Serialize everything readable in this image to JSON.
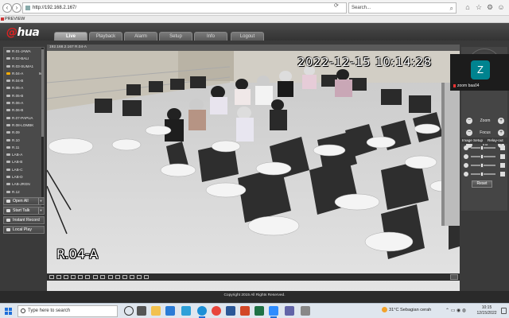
{
  "browser": {
    "url": "http://192.168.2.167/",
    "search_placeholder": "Search...",
    "tab_label": "PREVIEW"
  },
  "app": {
    "logo_main": "a",
    "logo_rest": "hua",
    "nav_tabs": [
      {
        "label": "Live",
        "active": true
      },
      {
        "label": "Playback",
        "active": false
      },
      {
        "label": "Alarm",
        "active": false
      },
      {
        "label": "Setup",
        "active": false
      },
      {
        "label": "Info",
        "active": false
      },
      {
        "label": "Logout",
        "active": false
      }
    ],
    "channels": [
      {
        "label": "R.01-JAWA",
        "active": false
      },
      {
        "label": "R.02-BALI",
        "active": false
      },
      {
        "label": "R.03-SUMA1",
        "active": false
      },
      {
        "label": "R.04-A",
        "active": true,
        "marker": "M"
      },
      {
        "label": "R.04-B",
        "active": false
      },
      {
        "label": "R.05-A",
        "active": false
      },
      {
        "label": "R.05-B",
        "active": false
      },
      {
        "label": "R.06-A",
        "active": false
      },
      {
        "label": "R.06-B",
        "active": false
      },
      {
        "label": "R.07-PAPUA",
        "active": false
      },
      {
        "label": "R.08-LOMBK",
        "active": false
      },
      {
        "label": "R.09",
        "active": false
      },
      {
        "label": "R.10",
        "active": false
      },
      {
        "label": "R.11",
        "active": false
      },
      {
        "label": "LAB-A",
        "active": false
      },
      {
        "label": "LAB-B",
        "active": false
      },
      {
        "label": "LAB-C",
        "active": false
      },
      {
        "label": "LAB-D",
        "active": false
      },
      {
        "label": "LAB-JRGN",
        "active": false
      },
      {
        "label": "R.12",
        "active": false
      }
    ],
    "side_buttons": {
      "open_all": "Open All",
      "start_talk": "Start Talk",
      "instant_record": "Instant Record",
      "local_play": "Local Play"
    },
    "video": {
      "header": "192.168.2.167 R.04-A",
      "timestamp": "2022-12-15 10:14:28",
      "channel_osd": "R.04-A"
    },
    "ptz": {
      "zoom": "Zoom",
      "focus": "Focus",
      "iris": "Iris"
    },
    "image_panel": {
      "image_setup": "Image Setup",
      "relay_out": "Relay-out",
      "reset": "Reset"
    },
    "footer": "Copyright 2015 All Rights Reserved."
  },
  "zoom": {
    "initial": "Z",
    "name": "zoom baa04"
  },
  "taskbar": {
    "search_placeholder": "Type here to search",
    "weather": "31°C  Sebagian cerah",
    "time": "10:15",
    "date": "12/15/2022"
  }
}
